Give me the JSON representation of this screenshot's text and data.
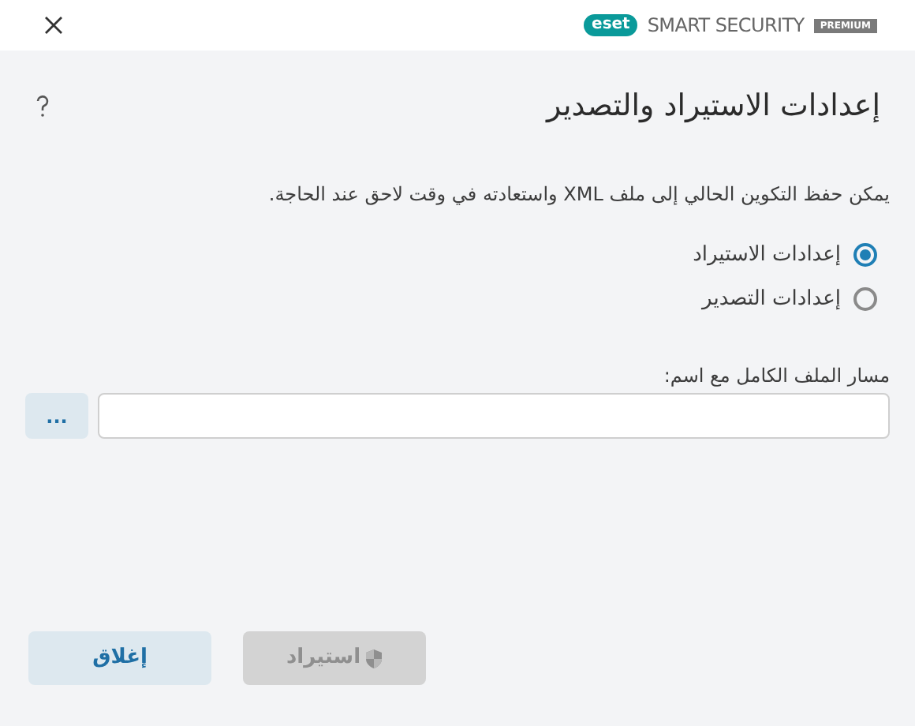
{
  "header": {
    "logo": "eset",
    "product": "SMART SECURITY",
    "edition": "PREMIUM"
  },
  "title": "إعدادات الاستيراد والتصدير",
  "description": "يمكن حفظ التكوين الحالي إلى ملف XML واستعادته في وقت لاحق عند الحاجة.",
  "options": [
    {
      "label": "إعدادات الاستيراد",
      "selected": true
    },
    {
      "label": "إعدادات التصدير",
      "selected": false
    }
  ],
  "path_field": {
    "label": "مسار الملف الكامل مع اسم:",
    "browse": "..."
  },
  "buttons": [
    {
      "label": "استيراد",
      "disabled": true,
      "kind": "shield"
    },
    {
      "label": "إغلاق",
      "disabled": false,
      "kind": "plain"
    }
  ]
}
